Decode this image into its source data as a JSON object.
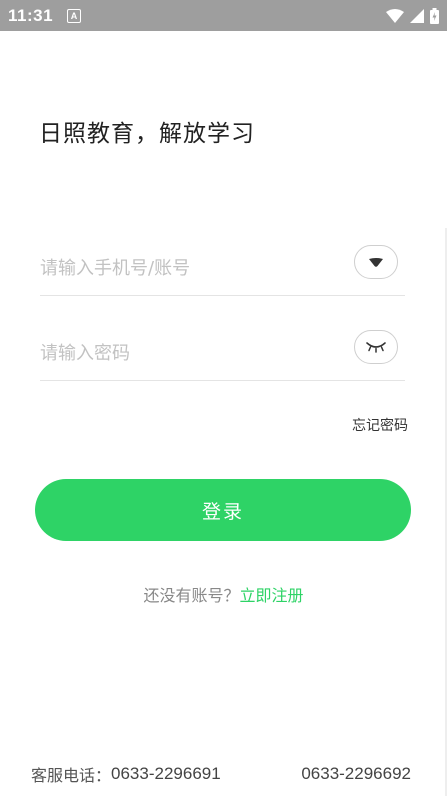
{
  "status_bar": {
    "time": "11:31",
    "notification_badge": "A"
  },
  "greeting": "日照教育，解放学习",
  "account_field": {
    "placeholder": "请输入手机号/账号",
    "value": "",
    "toggle_icon": "chevron-down-icon"
  },
  "password_field": {
    "placeholder": "请输入密码",
    "value": "",
    "toggle_icon": "eye-closed-icon"
  },
  "forgot_password": "忘记密码",
  "login_button": "登录",
  "register": {
    "prompt": "还没有账号？",
    "link": "立即注册"
  },
  "footer": {
    "label": "客服电话：",
    "phone1": "0633-2296691",
    "phone2": "0633-2296692"
  },
  "colors": {
    "accent": "#2ed366",
    "status_bar": "#9e9e9e"
  }
}
